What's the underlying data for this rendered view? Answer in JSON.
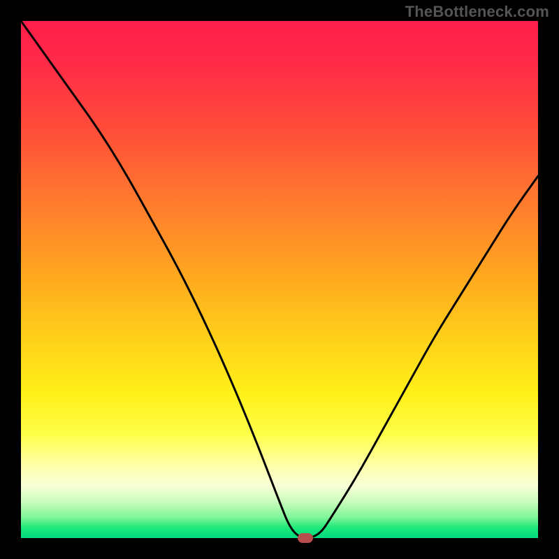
{
  "watermark": "TheBottleneck.com",
  "colors": {
    "frame_bg": "#000000",
    "curve": "#000000",
    "marker": "#b84d4d",
    "gradient_top": "#ff1e4a",
    "gradient_bottom": "#00db80"
  },
  "chart_data": {
    "type": "line",
    "title": "",
    "xlabel": "",
    "ylabel": "",
    "xlim": [
      0,
      100
    ],
    "ylim": [
      0,
      100
    ],
    "grid": false,
    "legend": false,
    "background": "vertical-rainbow-gradient (red top → green bottom) representing bottleneck severity",
    "series": [
      {
        "name": "bottleneck-curve",
        "x": [
          0,
          5,
          10,
          15,
          20,
          25,
          30,
          35,
          40,
          45,
          50,
          52,
          54,
          56,
          58,
          60,
          65,
          70,
          75,
          80,
          85,
          90,
          95,
          100
        ],
        "y": [
          100,
          93,
          86,
          79,
          71,
          62,
          53,
          43,
          32,
          20,
          7,
          2,
          0,
          0,
          1,
          4,
          12,
          21,
          30,
          39,
          47,
          55,
          63,
          70
        ]
      }
    ],
    "annotations": [
      {
        "name": "optimal-marker",
        "shape": "rounded-pill",
        "x": 55,
        "y": 0,
        "color": "#b84d4d"
      }
    ]
  }
}
